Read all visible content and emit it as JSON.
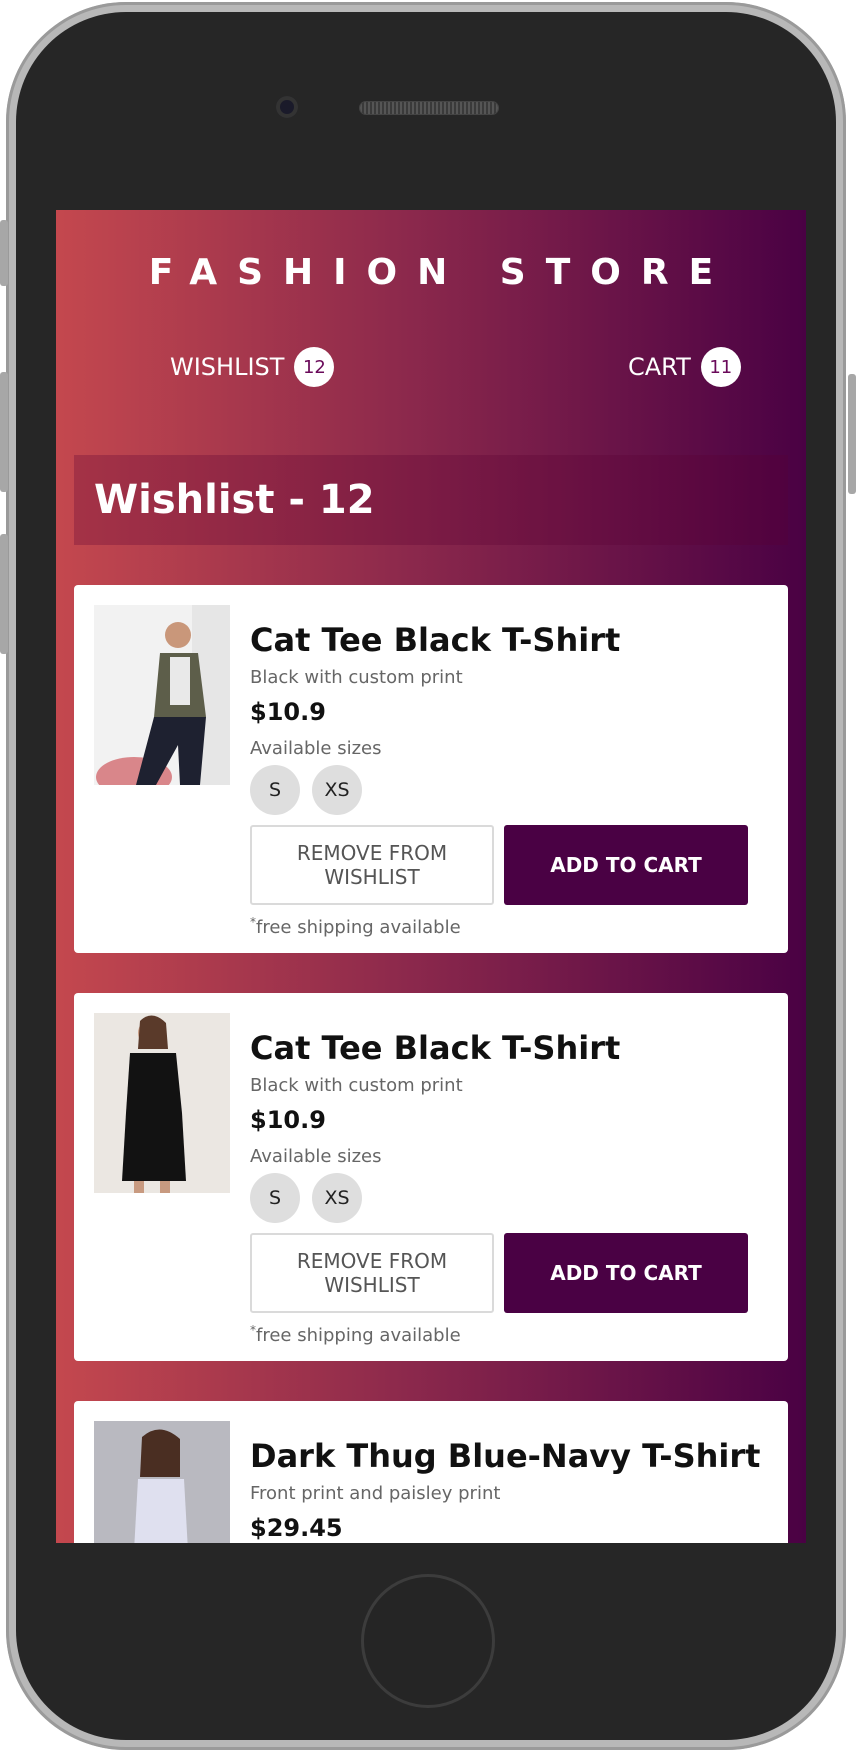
{
  "header": {
    "brand": "FASHION STORE",
    "nav": {
      "wishlist_label": "WISHLIST",
      "wishlist_count": "12",
      "cart_label": "CART",
      "cart_count": "11"
    }
  },
  "page": {
    "heading": "Wishlist - 12"
  },
  "products": [
    {
      "title": "Cat Tee Black T-Shirt",
      "description": "Black with custom print",
      "price": "$10.9",
      "sizes_label": "Available sizes",
      "sizes": [
        "S",
        "XS"
      ],
      "remove_label": "REMOVE FROM WISHLIST",
      "add_label": "ADD TO CART",
      "shipping_mark": "*",
      "shipping_text": "free shipping available"
    },
    {
      "title": "Cat Tee Black T-Shirt",
      "description": "Black with custom print",
      "price": "$10.9",
      "sizes_label": "Available sizes",
      "sizes": [
        "S",
        "XS"
      ],
      "remove_label": "REMOVE FROM WISHLIST",
      "add_label": "ADD TO CART",
      "shipping_mark": "*",
      "shipping_text": "free shipping available"
    },
    {
      "title": "Dark Thug Blue-Navy T-Shirt",
      "description": "Front print and paisley print",
      "price": "$29.45"
    }
  ],
  "colors": {
    "gradient_start": "#c4484e",
    "gradient_end": "#4a0144",
    "accent": "#4a0144"
  }
}
